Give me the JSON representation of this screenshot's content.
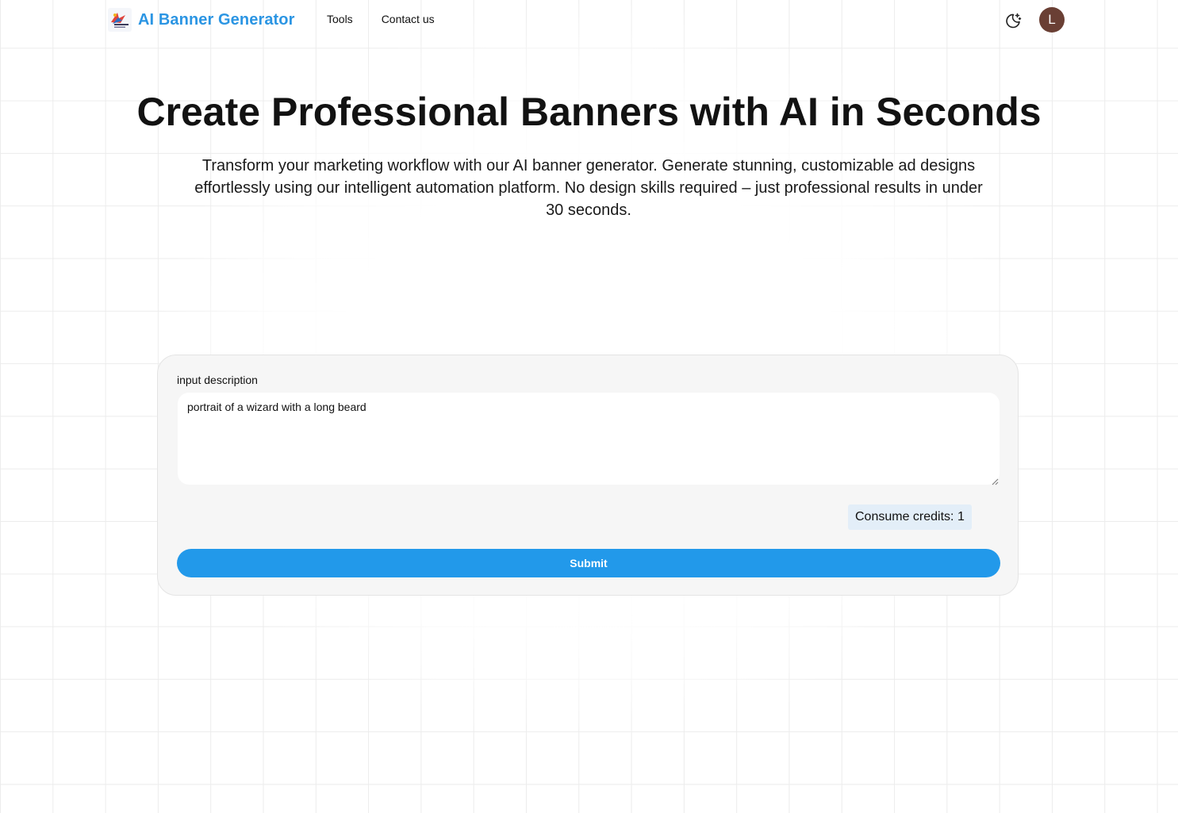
{
  "header": {
    "brand_name": "AI Banner Generator",
    "brand_color": "#2b95e3",
    "logo_icon": "banner-generator-logo",
    "nav": [
      {
        "label": "Tools"
      },
      {
        "label": "Contact us"
      }
    ],
    "theme_toggle_icon": "moon-sparkle-icon",
    "avatar_initial": "L",
    "avatar_color": "#6a3f34"
  },
  "hero": {
    "title": "Create Professional Banners with AI in Seconds",
    "subtitle": "Transform your marketing workflow with our AI banner generator. Generate stunning, customizable ad designs effortlessly using our intelligent automation platform. No design skills required – just professional results in under 30 seconds."
  },
  "form": {
    "label": "input description",
    "description_value": "portrait of a wizard with a long beard",
    "credits_text": "Consume credits: 1",
    "submit_label": "Submit",
    "submit_color": "#2299ea"
  }
}
